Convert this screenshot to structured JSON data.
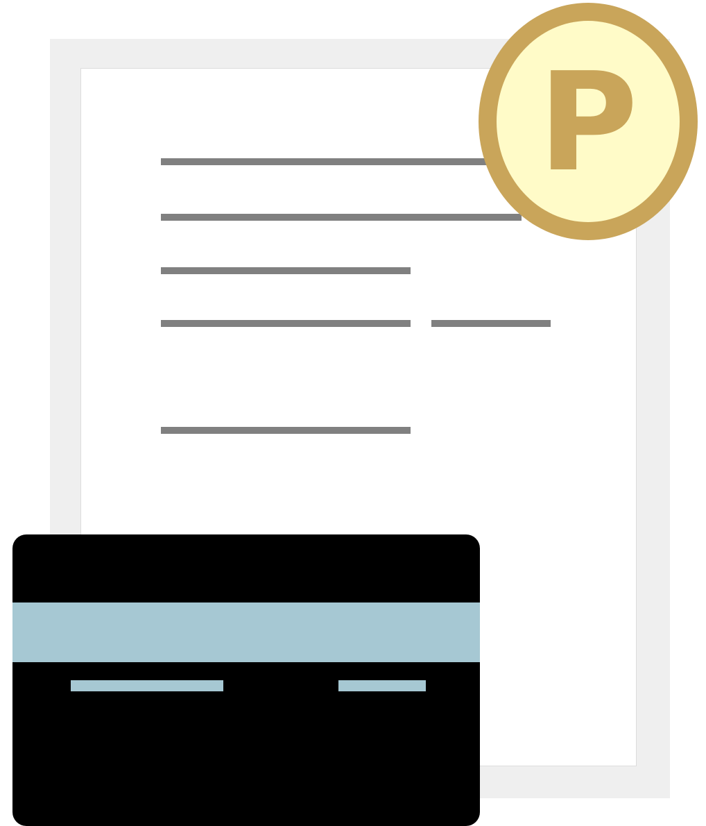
{
  "document": {
    "page_color": "#ffffff",
    "shadow_color": "#efefef",
    "line_color": "#808080"
  },
  "badge": {
    "letter": "P",
    "ring_color": "#c9a55a",
    "fill_color": "#fffbc8"
  },
  "card": {
    "body_color": "#000000",
    "stripe_color": "#a6c8d3"
  }
}
